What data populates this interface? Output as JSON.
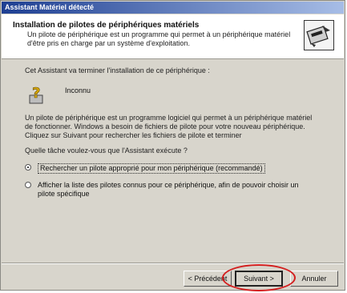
{
  "window": {
    "title": "Assistant Matériel détecté"
  },
  "header": {
    "title": "Installation de pilotes de périphériques matériels",
    "subtitle": "Un pilote de périphérique est un programme qui permet à un périphérique matériel d'être pris en charge par un système d'exploitation.",
    "icon": "hardware-wizard-icon"
  },
  "content": {
    "intro": "Cet Assistant va terminer l'installation de ce périphérique :",
    "device": {
      "icon": "unknown-device-icon",
      "name": "Inconnu"
    },
    "description": "Un pilote de périphérique est un programme logiciel qui permet à un périphérique matériel de fonctionner. Windows a besoin de fichiers de pilote pour votre nouveau périphérique. Cliquez sur Suivant pour rechercher les fichiers de pilote et terminer",
    "question": "Quelle tâche voulez-vous que l'Assistant exécute ?",
    "options": [
      {
        "label": "Rechercher un pilote approprié pour mon périphérique (recommandé)",
        "selected": true
      },
      {
        "label": "Afficher la liste des pilotes connus pour ce périphérique, afin de pouvoir choisir un pilote spécifique",
        "selected": false
      }
    ]
  },
  "buttons": {
    "back": "< Précédent",
    "next": "Suivant >",
    "cancel": "Annuler"
  },
  "colors": {
    "highlight": "#d41f1f",
    "titlebar": "#1e3f92"
  }
}
